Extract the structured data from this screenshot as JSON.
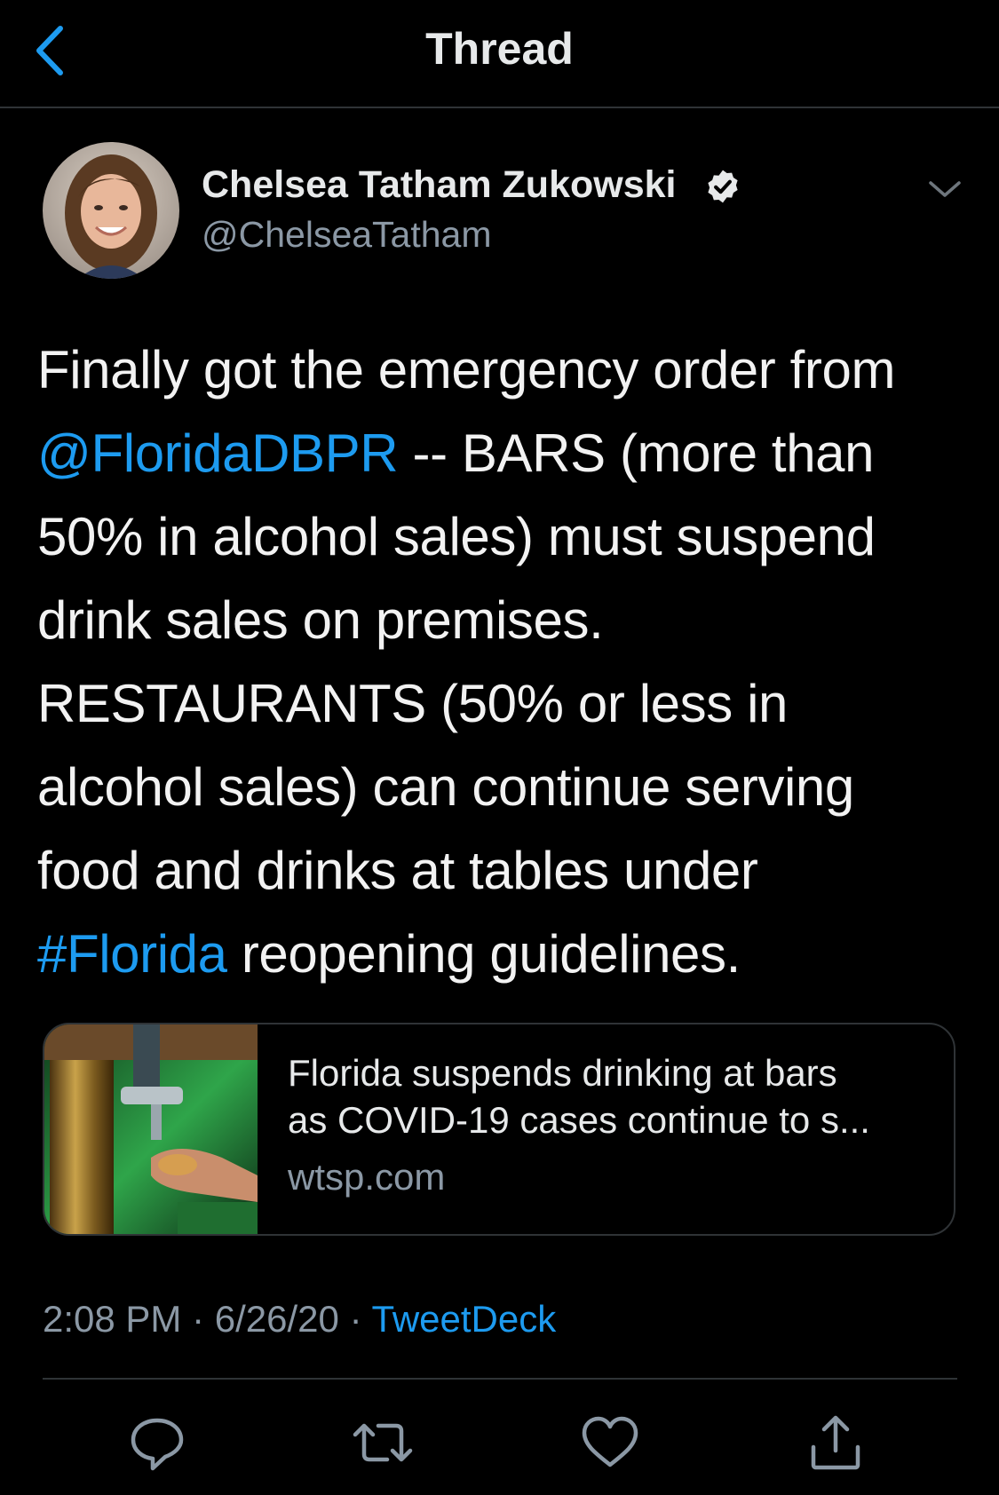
{
  "header": {
    "title": "Thread"
  },
  "tweet": {
    "author_name": "Chelsea Tatham Zukowski",
    "author_handle": "@ChelseaTatham",
    "verified": true,
    "text_lines": [
      [
        {
          "text": "Finally got the emergency order from",
          "link": false
        }
      ],
      [
        {
          "text": "@FloridaDBPR",
          "link": true
        },
        {
          "text": " -- BARS (more than",
          "link": false
        }
      ],
      [
        {
          "text": "50% in alcohol sales) must suspend",
          "link": false
        }
      ],
      [
        {
          "text": "drink sales on premises.",
          "link": false
        }
      ],
      [
        {
          "text": "RESTAURANTS (50% or less in",
          "link": false
        }
      ],
      [
        {
          "text": "alcohol sales) can continue serving",
          "link": false
        }
      ],
      [
        {
          "text": "food and drinks at tables under",
          "link": false
        }
      ],
      [
        {
          "text": "#Florida",
          "link": true
        },
        {
          "text": " reopening guidelines.",
          "link": false
        }
      ]
    ],
    "time": "2:08 PM",
    "date": "6/26/20",
    "separator": "·",
    "source": "TweetDeck"
  },
  "link_card": {
    "title_line1": "Florida suspends drinking at bars",
    "title_line2": "as COVID-19 cases continue to s...",
    "domain": "wtsp.com"
  },
  "icons": {
    "back": "back-chevron-icon",
    "verified": "verified-badge-icon",
    "caret": "chevron-down-icon",
    "reply": "reply-icon",
    "retweet": "retweet-icon",
    "like": "like-icon",
    "share": "share-icon"
  },
  "colors": {
    "background": "#000000",
    "text": "#e7e9ea",
    "secondary": "#8b98a5",
    "accent": "#1d9bf0",
    "divider": "#2f3336"
  }
}
